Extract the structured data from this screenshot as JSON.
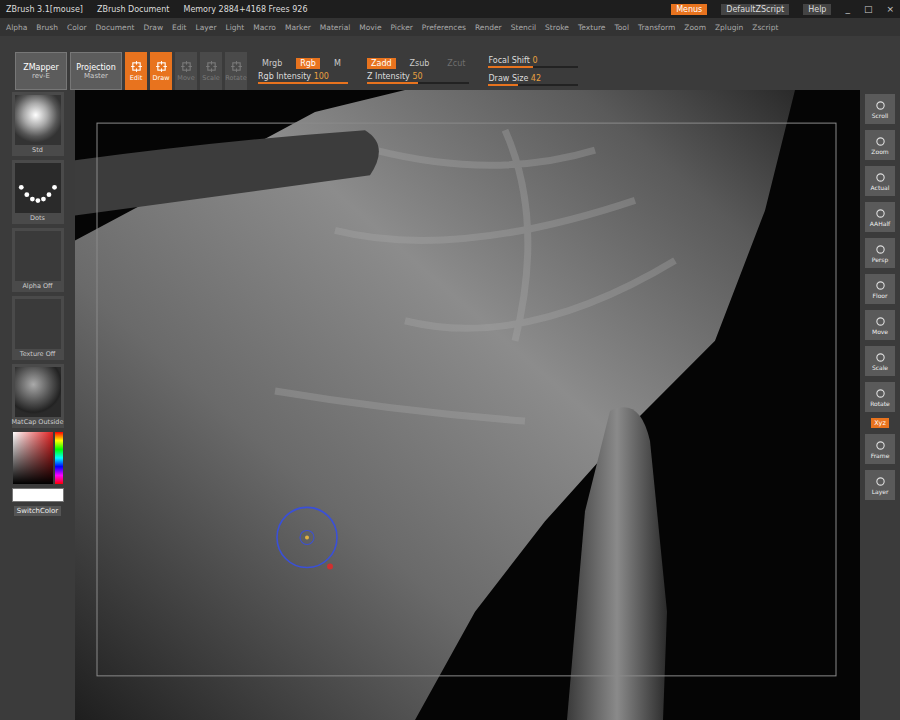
{
  "titlebar": {
    "app": "ZBrush 3.1[mouse]",
    "document": "ZBrush Document",
    "memory": "Memory 2884+4168 Frees 926",
    "buttons": [
      {
        "label": "Menus",
        "selected": true
      },
      {
        "label": "DefaultZScript",
        "selected": false
      },
      {
        "label": "Help",
        "selected": false
      }
    ],
    "window_controls": [
      "_",
      "□",
      "×"
    ]
  },
  "menus": [
    "Alpha",
    "Brush",
    "Color",
    "Document",
    "Draw",
    "Edit",
    "Layer",
    "Light",
    "Macro",
    "Marker",
    "Material",
    "Movie",
    "Picker",
    "Preferences",
    "Render",
    "Stencil",
    "Stroke",
    "Texture",
    "Tool",
    "Transform",
    "Zoom",
    "Zplugin",
    "Zscript"
  ],
  "shelf": {
    "plugins": [
      {
        "label": "ZMapper",
        "sub": "rev-E"
      },
      {
        "label": "Projection",
        "sub": "Master"
      }
    ],
    "modes": [
      {
        "label": "Edit",
        "selected": true,
        "disabled": false
      },
      {
        "label": "Draw",
        "selected": true,
        "disabled": false
      },
      {
        "label": "Move",
        "selected": false,
        "disabled": true
      },
      {
        "label": "Scale",
        "selected": false,
        "disabled": true
      },
      {
        "label": "Rotate",
        "selected": false,
        "disabled": true
      }
    ],
    "rgb_group": {
      "buttons": [
        {
          "label": "Mrgb",
          "selected": false,
          "disabled": false
        },
        {
          "label": "Rgb",
          "selected": true,
          "disabled": false
        },
        {
          "label": "M",
          "selected": false,
          "disabled": false
        }
      ],
      "slider": {
        "label": "Rgb Intensity",
        "value": "100",
        "level": 1
      }
    },
    "z_group": {
      "buttons": [
        {
          "label": "Zadd",
          "selected": true,
          "disabled": false
        },
        {
          "label": "Zsub",
          "selected": false,
          "disabled": false
        },
        {
          "label": "Zcut",
          "selected": false,
          "disabled": true
        }
      ],
      "slider": {
        "label": "Z Intensity",
        "value": "50",
        "level": 0.5
      }
    },
    "brush_sliders": [
      {
        "label": "Focal Shift",
        "value": "0",
        "level": 0.5
      },
      {
        "label": "Draw Size",
        "value": "42",
        "level": 0.33
      }
    ]
  },
  "left_shelf": {
    "tiles": [
      {
        "kind": "brush",
        "label": "Std"
      },
      {
        "kind": "stroke",
        "label": "Dots"
      },
      {
        "kind": "alpha",
        "label": "Alpha Off"
      },
      {
        "kind": "texture",
        "label": "Texture Off"
      },
      {
        "kind": "material",
        "label": "MatCap Outside"
      }
    ],
    "switch_color": "SwitchColor"
  },
  "right_shelf": [
    {
      "kind": "button",
      "label": "Scroll",
      "selected": false
    },
    {
      "kind": "button",
      "label": "Zoom",
      "selected": false
    },
    {
      "kind": "button",
      "label": "Actual",
      "selected": false
    },
    {
      "kind": "button",
      "label": "AAHalf",
      "selected": false
    },
    {
      "kind": "button",
      "label": "Persp",
      "selected": false
    },
    {
      "kind": "button",
      "label": "Floor",
      "selected": false
    },
    {
      "kind": "button",
      "label": "Move",
      "selected": false
    },
    {
      "kind": "button",
      "label": "Scale",
      "selected": false
    },
    {
      "kind": "button",
      "label": "Rotate",
      "selected": false
    },
    {
      "kind": "tag",
      "label": "Xyz",
      "selected": true
    },
    {
      "kind": "button",
      "label": "Frame",
      "selected": false
    },
    {
      "kind": "button",
      "label": "Layer",
      "selected": false
    }
  ]
}
